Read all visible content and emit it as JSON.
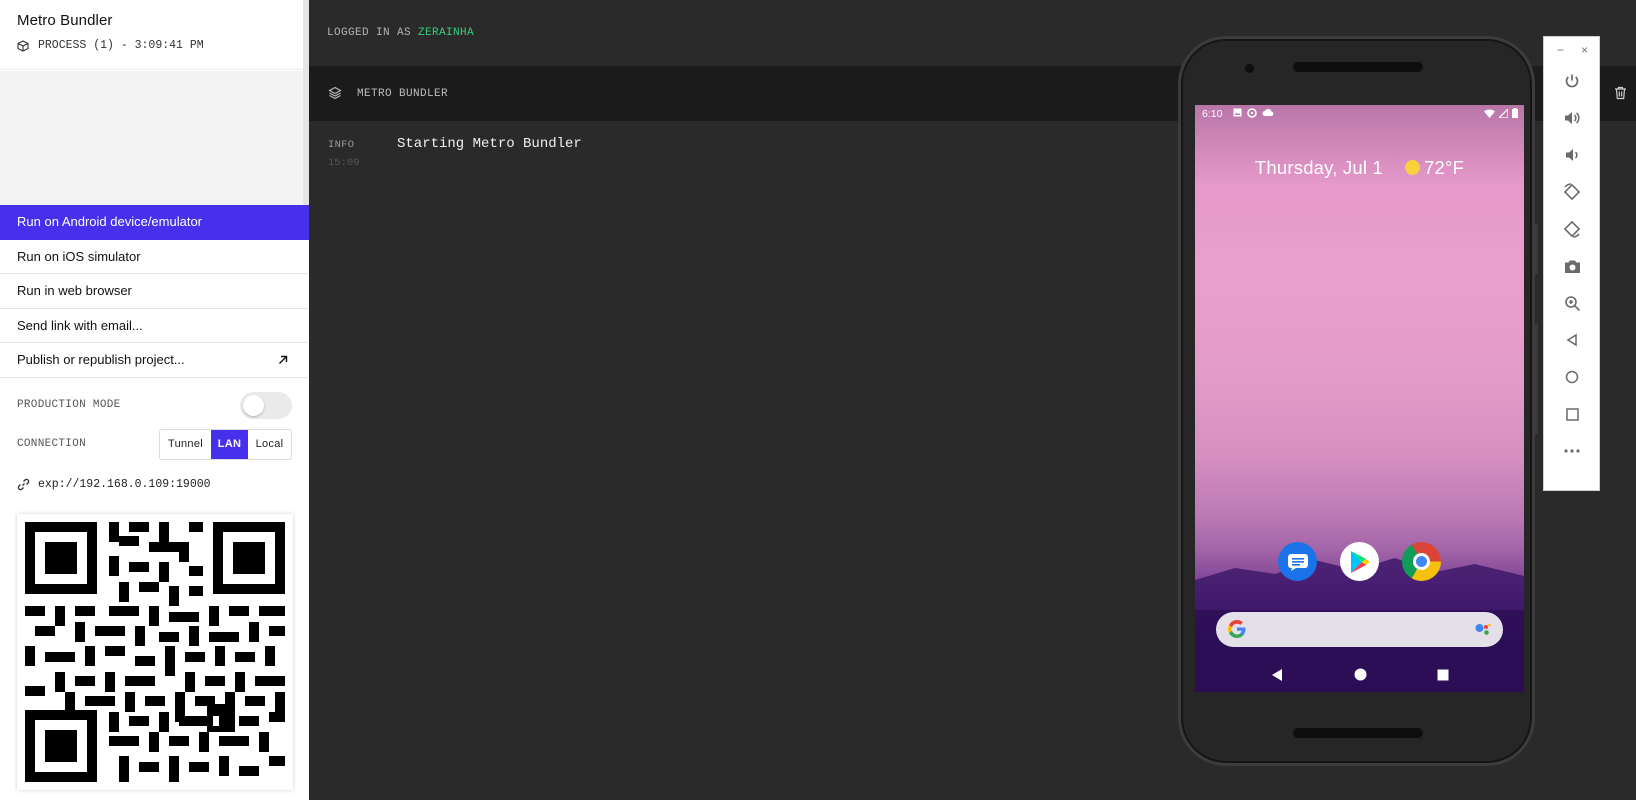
{
  "sidebar": {
    "title": "Metro Bundler",
    "process": "PROCESS (1) - 3:09:41 PM",
    "menu": [
      {
        "label": "Run on Android device/emulator",
        "active": true
      },
      {
        "label": "Run on iOS simulator"
      },
      {
        "label": "Run in web browser"
      },
      {
        "label": "Send link with email..."
      },
      {
        "label": "Publish or republish project...",
        "icon": "external-arrow-icon"
      }
    ],
    "production_mode_label": "PRODUCTION MODE",
    "production_mode_on": false,
    "connection_label": "CONNECTION",
    "connection_options": [
      "Tunnel",
      "LAN",
      "Local"
    ],
    "connection_selected": "LAN",
    "url": "exp://192.168.0.109:19000"
  },
  "header": {
    "logged_prefix": "LOGGED IN AS",
    "username": "ZERAINHA"
  },
  "log_panel": {
    "title": "METRO BUNDLER",
    "entries": [
      {
        "level": "INFO",
        "time": "15:09",
        "message": "Starting Metro Bundler"
      }
    ]
  },
  "emulator": {
    "status_time": "6:10",
    "date": "Thursday, Jul 1",
    "temperature": "72°F",
    "dock_apps": [
      "messages-icon",
      "play-store-icon",
      "chrome-icon"
    ],
    "toolbar": [
      "power-icon",
      "volume-up-icon",
      "volume-down-icon",
      "rotate-left-icon",
      "rotate-right-icon",
      "camera-icon",
      "zoom-icon",
      "back-icon",
      "home-icon",
      "overview-icon",
      "more-icon"
    ]
  },
  "colors": {
    "accent": "#4630eb",
    "username": "#35d07a",
    "panel_bg": "#2a2a2a"
  }
}
